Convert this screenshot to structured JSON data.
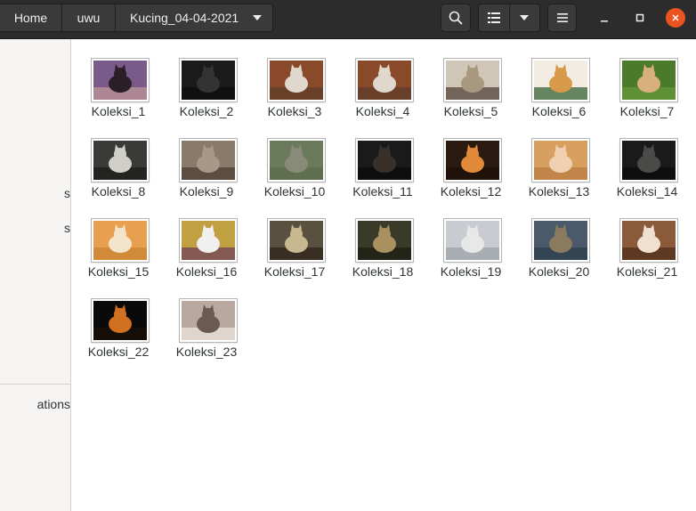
{
  "breadcrumbs": {
    "home": "Home",
    "folder": "uwu",
    "current": "Kucing_04-04-2021"
  },
  "icons": {
    "search": "search-icon",
    "list_view": "list-view-icon",
    "view_options": "chevron-down-icon",
    "menu": "hamburger-menu-icon",
    "minimize": "minimize-icon",
    "maximize": "maximize-icon",
    "close": "close-icon",
    "dropdown": "caret-down-icon"
  },
  "colors": {
    "headerbar": "#2c2c2c",
    "close_button": "#e95420",
    "sidebar": "#f6f5f4"
  },
  "sidebar": {
    "items": [
      "s",
      "s",
      "ations"
    ]
  },
  "files": [
    {
      "name": "Koleksi_1",
      "colors": [
        "#7a5a8a",
        "#2a1f25",
        "#c49a9a"
      ]
    },
    {
      "name": "Koleksi_2",
      "colors": [
        "#1a1a1a",
        "#333333",
        "#0d0d0d"
      ]
    },
    {
      "name": "Koleksi_3",
      "colors": [
        "#8a4a2a",
        "#e0d8cc",
        "#5a3a2a"
      ]
    },
    {
      "name": "Koleksi_4",
      "colors": [
        "#8a4a2a",
        "#e0d8cc",
        "#5a3a2a"
      ]
    },
    {
      "name": "Koleksi_5",
      "colors": [
        "#cfc6b8",
        "#a89880",
        "#4a3a30"
      ]
    },
    {
      "name": "Koleksi_6",
      "colors": [
        "#f2ece2",
        "#d89a4a",
        "#2a5a2a"
      ]
    },
    {
      "name": "Koleksi_7",
      "colors": [
        "#4a7a2a",
        "#d8b080",
        "#6a9a3a"
      ]
    },
    {
      "name": "Koleksi_8",
      "colors": [
        "#3a3a38",
        "#cfcfc8",
        "#1a1a18"
      ]
    },
    {
      "name": "Koleksi_9",
      "colors": [
        "#8a7a6a",
        "#a89888",
        "#4a3a30"
      ]
    },
    {
      "name": "Koleksi_10",
      "colors": [
        "#6a7a5a",
        "#8a8a7a",
        "#5a6a4a"
      ]
    },
    {
      "name": "Koleksi_11",
      "colors": [
        "#1a1a1a",
        "#3a3028",
        "#0a0a0a"
      ]
    },
    {
      "name": "Koleksi_12",
      "colors": [
        "#2a1a10",
        "#e08a3a",
        "#1a0f08"
      ]
    },
    {
      "name": "Koleksi_13",
      "colors": [
        "#d8a060",
        "#f0d0b0",
        "#b87840"
      ]
    },
    {
      "name": "Koleksi_14",
      "colors": [
        "#1a1a1a",
        "#4a4a48",
        "#0a0a0a"
      ]
    },
    {
      "name": "Koleksi_15",
      "colors": [
        "#e8a050",
        "#f4e4cc",
        "#c88030"
      ]
    },
    {
      "name": "Koleksi_16",
      "colors": [
        "#c0a040",
        "#f0f0f0",
        "#6a3a5a"
      ]
    },
    {
      "name": "Koleksi_17",
      "colors": [
        "#5a5040",
        "#c8b890",
        "#2a2018"
      ]
    },
    {
      "name": "Koleksi_18",
      "colors": [
        "#3a3a28",
        "#a89060",
        "#1a1a10"
      ]
    },
    {
      "name": "Koleksi_19",
      "colors": [
        "#c8ccd0",
        "#e8e8e8",
        "#9aa0a8"
      ]
    },
    {
      "name": "Koleksi_20",
      "colors": [
        "#4a5a6a",
        "#8a7a60",
        "#2a3a4a"
      ]
    },
    {
      "name": "Koleksi_21",
      "colors": [
        "#8a5a3a",
        "#f0e0d0",
        "#4a2a1a"
      ]
    },
    {
      "name": "Koleksi_22",
      "colors": [
        "#0a0a0a",
        "#d07020",
        "#1a1008"
      ]
    },
    {
      "name": "Koleksi_23",
      "colors": [
        "#b8a8a0",
        "#6a5a50",
        "#f0e8e0"
      ]
    }
  ]
}
